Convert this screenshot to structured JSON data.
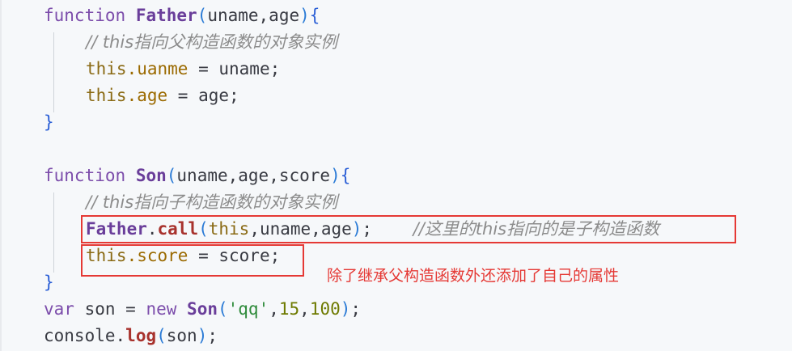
{
  "code": {
    "l1": {
      "kw": "function",
      "name": "Father",
      "params": "uname,age",
      "open": "{"
    },
    "l2": {
      "comment": "// this指向父构造函数的对象实例"
    },
    "l3": {
      "this": "this",
      "prop": ".uanme",
      "op": " = ",
      "val": "uname",
      "end": ";"
    },
    "l4": {
      "this": "this",
      "prop": ".age",
      "op": " = ",
      "val": "age",
      "end": ";"
    },
    "l5": {
      "close": "}"
    },
    "l7": {
      "kw": "function",
      "name": "Son",
      "params": "uname,age,score",
      "open": "{"
    },
    "l8": {
      "comment": "// this指向子构造函数的对象实例"
    },
    "l9": {
      "obj": "Father",
      "dot": ".",
      "method": "call",
      "args_this": "this",
      "args_rest": ",uname,age",
      "end": ";",
      "comment": "//这里的this指向的是子构造函数"
    },
    "l10": {
      "this": "this",
      "prop": ".score",
      "op": " = ",
      "val": "score",
      "end": ";"
    },
    "l11": {
      "close": "}"
    },
    "l12": {
      "kw": "var",
      "var": " son = ",
      "new": "new",
      "cls": "Son",
      "str": "'qq'",
      "n1": "15",
      "n2": "100",
      "end": ";"
    },
    "l13": {
      "obj": "console",
      "dot": ".",
      "method": "log",
      "arg": "son",
      "end": ";"
    }
  },
  "annotation": {
    "text": "除了继承父构造函数外还添加了自己的属性",
    "color": "#e53935"
  }
}
